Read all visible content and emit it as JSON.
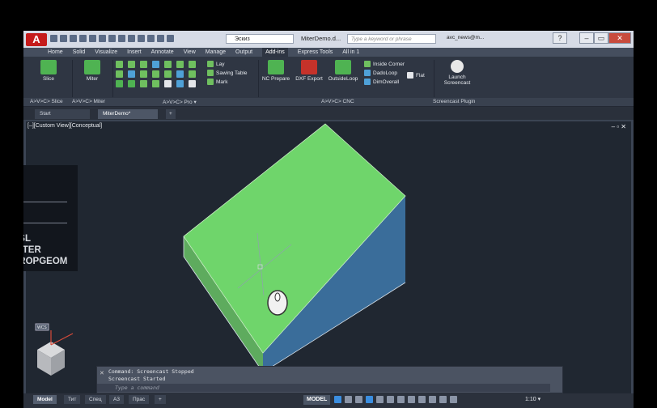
{
  "app": {
    "logo": "A",
    "workspace": "Эскиз",
    "document_title": "MiterDemo.d...",
    "search_placeholder": "Type a keyword or phrase",
    "user": "avc_news@m...",
    "help": "?"
  },
  "window_controls": {
    "minimize": "–",
    "restore": "▭",
    "close": "✕"
  },
  "menu_tabs": [
    "Home",
    "Solid",
    "Visualize",
    "Insert",
    "Annotate",
    "View",
    "Manage",
    "Output",
    "Add-ins",
    "Express Tools",
    "All in 1"
  ],
  "active_menu_tab": "Add-ins",
  "ribbon": {
    "slice_label": "Slice",
    "miter_label": "Miter",
    "lay_label": "Lay",
    "sawing_table_label": "Sawing Table",
    "mark_label": "Mark",
    "nc_prepare_label": "NC Prepare",
    "dxf_export_label": "DXF Export",
    "outside_loop_label": "OutsideLoop",
    "inside_corner_label": "Inside Corner",
    "dado_loop_label": "DadoLoop",
    "flat_label": "Flat",
    "dim_overall_label": "DimOverall",
    "launch_screencast_line1": "Launch",
    "launch_screencast_line2": "Screencast",
    "panel_slice": "A>V>C> Slice",
    "panel_miter": "A>V>C> Miter",
    "panel_pro": "A>V>C> Pro ▾",
    "panel_cnc": "A>V>C> CNC",
    "panel_screencast": "Screencast Plugin"
  },
  "doc_tabs": {
    "start": "Start",
    "active": "MiterDemo*",
    "add": "+"
  },
  "viewport": {
    "label": "[–][Custom View][Conceptual]",
    "controls": "–  ▫  ✕",
    "overlay_line1": "ASL",
    "overlay_line2": "MITER",
    "overlay_line3": "DROPGEOM",
    "wcs_label": "WCS"
  },
  "command": {
    "history_1": "Command: Screencast Stopped",
    "history_2": "Screencast Started",
    "placeholder": "Type a command",
    "close": "✕"
  },
  "layout_tabs": [
    "Model",
    "Тит",
    "Спец",
    "А3",
    "Прас",
    "+"
  ],
  "active_layout_tab": "Model",
  "status": {
    "model": "MODEL",
    "scale": "1:10 ▾"
  },
  "colors": {
    "top_face": "#6fd56b",
    "side_left": "#5eab5e",
    "side_right": "#3a6d9a",
    "accent": "#c51b1b"
  }
}
